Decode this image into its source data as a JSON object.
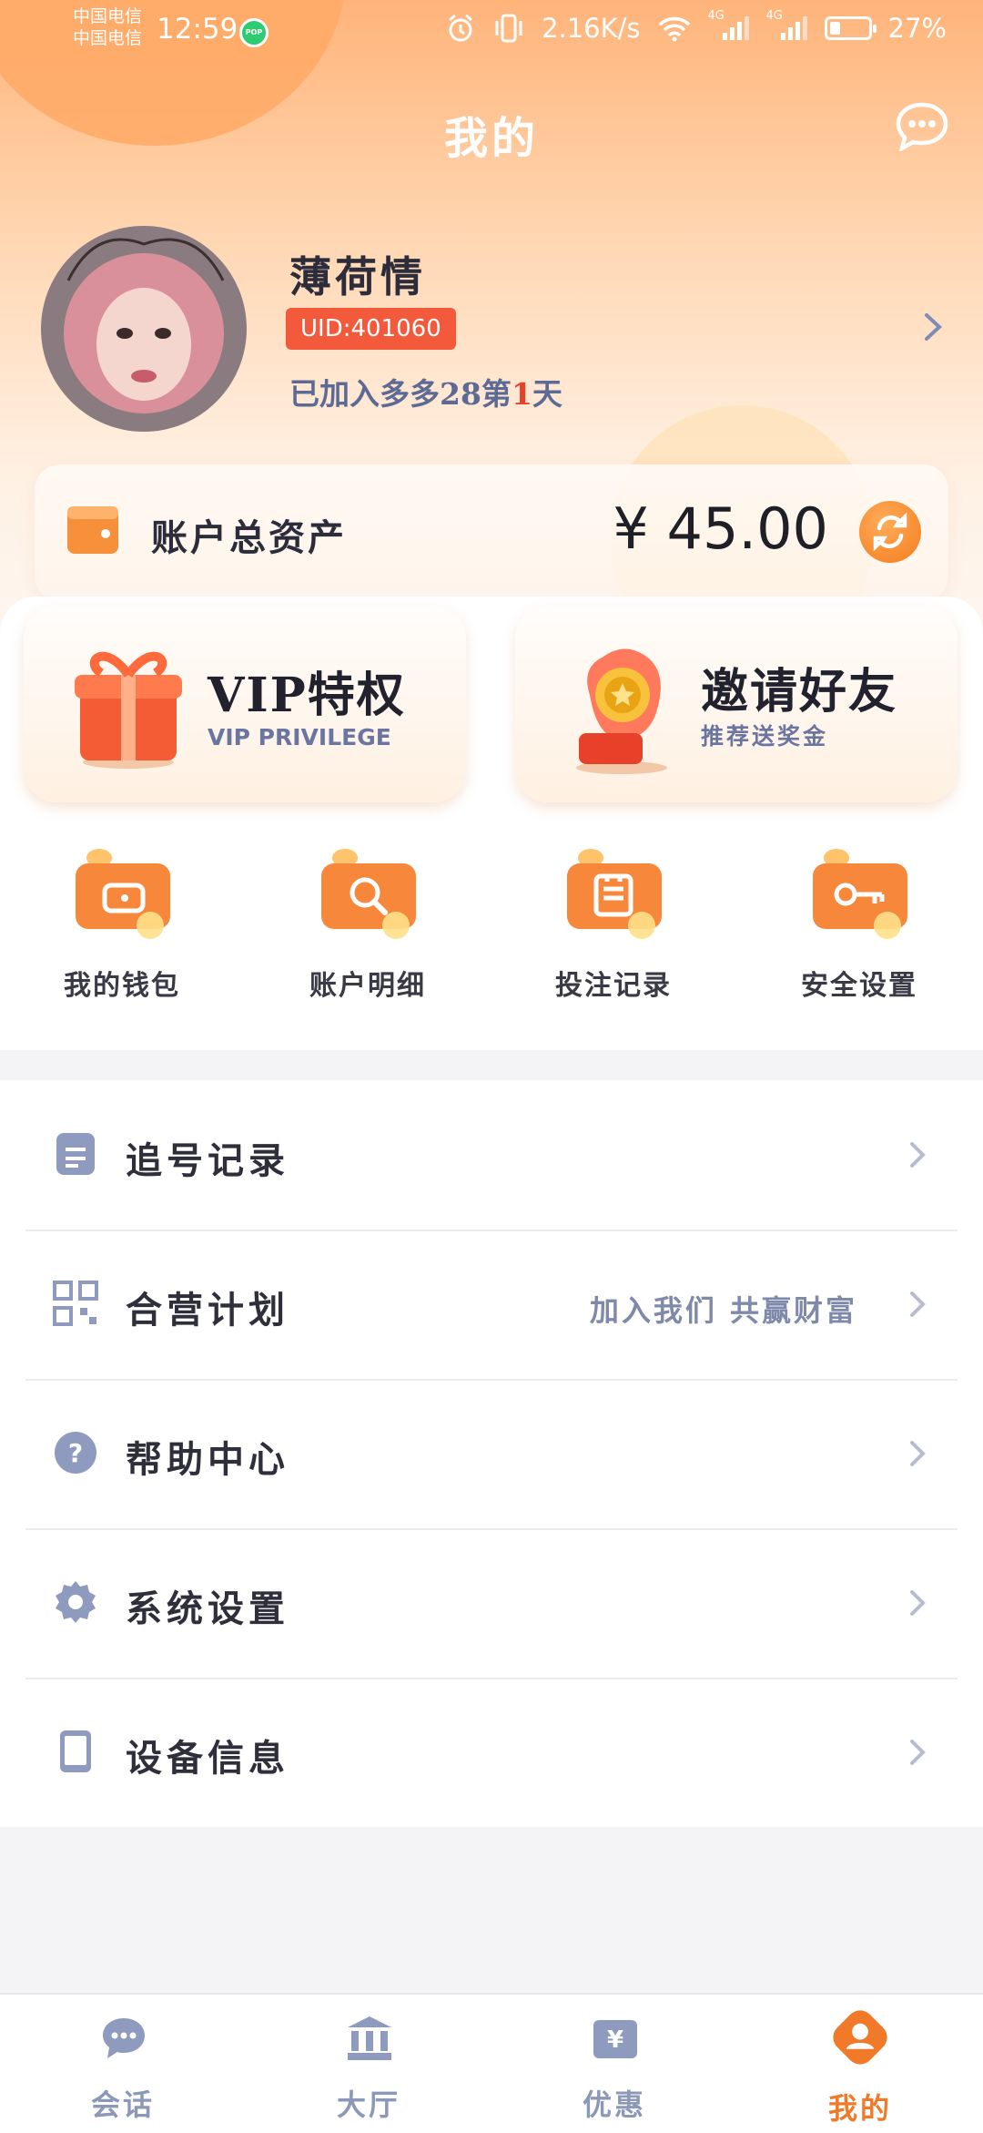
{
  "status_bar": {
    "carrier1": "中国电信",
    "carrier2": "中国电信",
    "time": "12:59",
    "pop_badge": "POP",
    "net_speed": "2.16K/s",
    "signal1": "4G",
    "signal2": "4G",
    "battery": "27%",
    "battery_level": 0.27
  },
  "header": {
    "title": "我的"
  },
  "profile": {
    "nickname": "薄荷情",
    "uid": "UID:401060",
    "joined_prefix": "已加入多多28第",
    "joined_days": "1",
    "joined_suffix": "天"
  },
  "assets": {
    "label": "账户总资产",
    "balance": "¥ 45.00"
  },
  "promos": {
    "vip": {
      "title": "VIP特权",
      "subtitle": "VIP PRIVILEGE"
    },
    "invite": {
      "title": "邀请好友",
      "subtitle": "推荐送奖金"
    }
  },
  "quick_actions": [
    {
      "label": "我的钱包"
    },
    {
      "label": "账户明细"
    },
    {
      "label": "投注记录"
    },
    {
      "label": "安全设置"
    }
  ],
  "menu": [
    {
      "label": "追号记录",
      "hint": ""
    },
    {
      "label": "合营计划",
      "hint": "加入我们 共赢财富"
    },
    {
      "label": "帮助中心",
      "hint": ""
    },
    {
      "label": "系统设置",
      "hint": ""
    },
    {
      "label": "设备信息",
      "hint": ""
    }
  ],
  "tabs": [
    {
      "label": "会话"
    },
    {
      "label": "大厅"
    },
    {
      "label": "优惠"
    },
    {
      "label": "我的"
    }
  ],
  "colors": {
    "accent": "#f07a2a",
    "uid_badge": "#f35a3c",
    "menu_icon": "#8f9abf"
  }
}
